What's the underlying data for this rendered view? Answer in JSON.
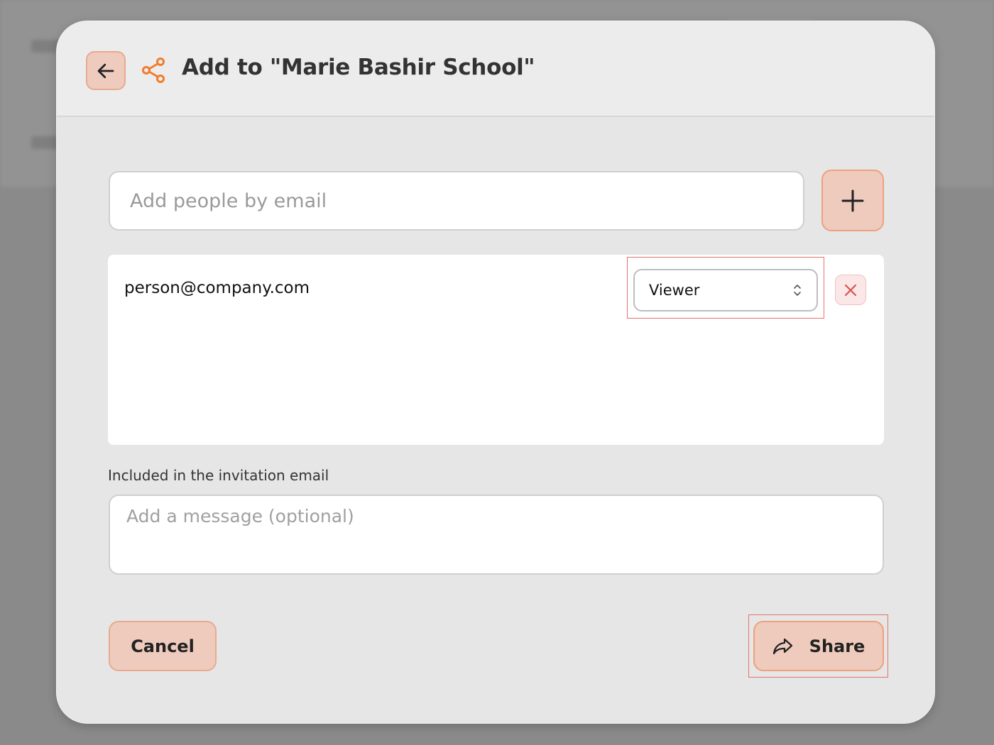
{
  "dialog": {
    "title": "Add to \"Marie Bashir School\""
  },
  "email_input": {
    "placeholder": "Add people by email",
    "value": ""
  },
  "people": [
    {
      "email": "person@company.com",
      "role": "Viewer"
    }
  ],
  "message": {
    "label": "Included in the invitation email",
    "placeholder": "Add a message (optional)",
    "value": ""
  },
  "actions": {
    "cancel_label": "Cancel",
    "share_label": "Share"
  },
  "icons": {
    "back": "arrow-left-icon",
    "share_nodes": "share-nodes-icon",
    "add": "plus-icon",
    "role_toggle": "chevron-up-down-icon",
    "remove": "close-icon",
    "share": "forward-arrow-icon"
  },
  "colors": {
    "accent": "#F07D2E",
    "button_fill": "#EFCBBD",
    "button_border": "#E8AA90",
    "remove_x": "#D9534F",
    "highlight": "#E2746F"
  }
}
